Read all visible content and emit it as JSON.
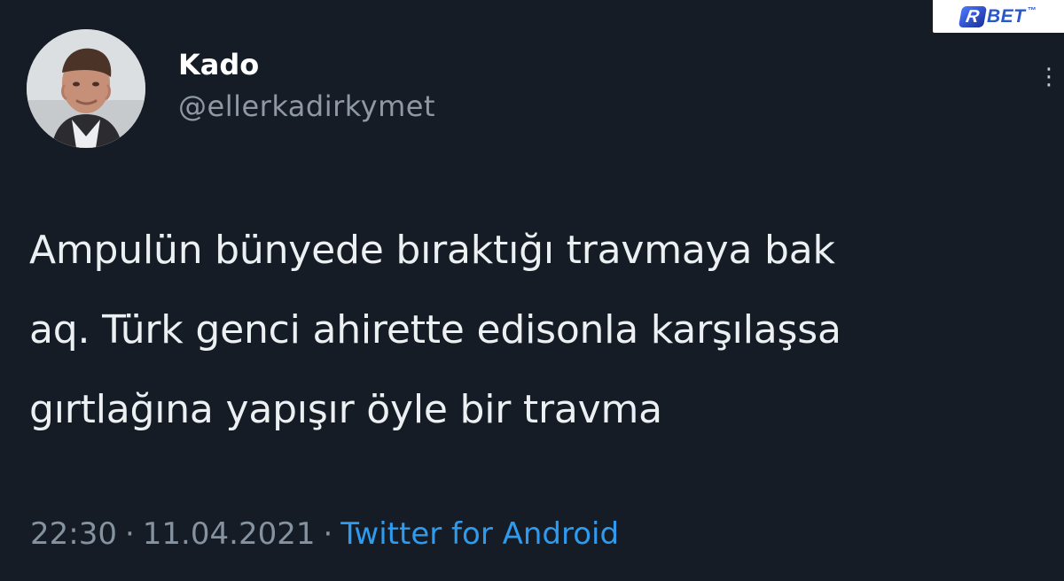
{
  "tweet": {
    "display_name": "Kado",
    "handle": "@ellerkadirkymet",
    "text_lines": [
      "Ampulün bünyede bıraktığı travmaya bak",
      "aq. Türk genci ahirette edisonla karşılaşsa",
      "gırtlağına yapışır öyle bir travma"
    ],
    "time": "22:30",
    "date": "11.04.2021",
    "source": "Twitter for Android",
    "separator": "·",
    "more_icon": "more-vertical-icon",
    "avatar_icon": "user-avatar-photo"
  },
  "watermark": {
    "brand": "BET",
    "symbol": "R",
    "trademark": "™",
    "icon": "rbet-logo-icon"
  },
  "colors": {
    "background": "#151c26",
    "text": "#edf0f2",
    "muted": "#8592a0",
    "link": "#2f9bef"
  }
}
